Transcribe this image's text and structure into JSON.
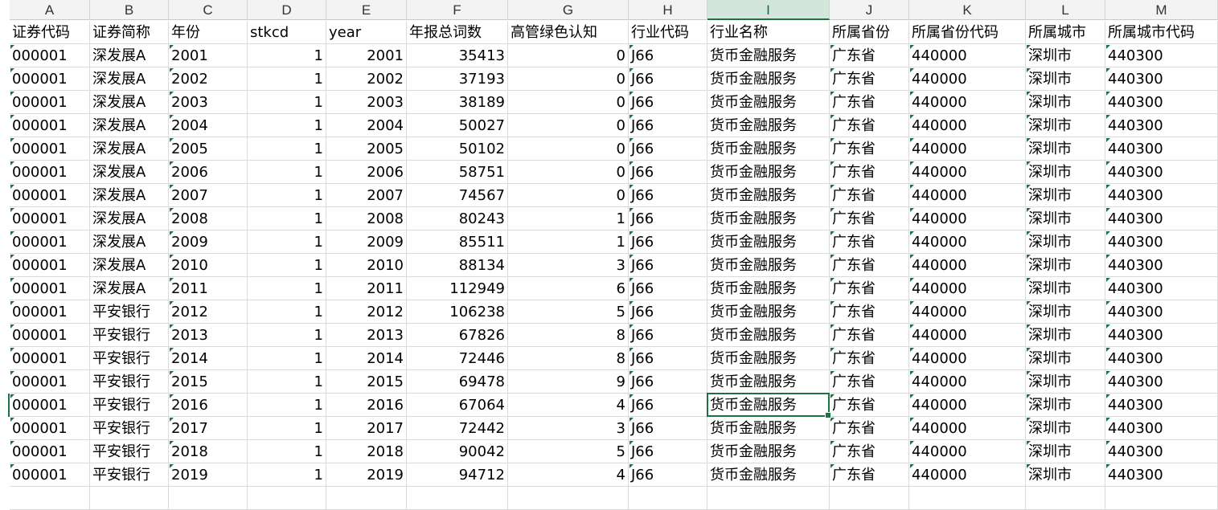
{
  "columns": [
    "A",
    "B",
    "C",
    "D",
    "E",
    "F",
    "G",
    "H",
    "I",
    "J",
    "K",
    "L",
    "M"
  ],
  "active_column": "I",
  "header_row": [
    "证券代码",
    "证券简称",
    "年份",
    "stkcd",
    "year",
    "年报总词数",
    "高管绿色认知",
    "行业代码",
    "行业名称",
    "所属省份",
    "所属省份代码",
    "所属城市",
    "所属城市代码"
  ],
  "rows": [
    [
      "000001",
      "深发展A",
      "2001",
      "1",
      "2001",
      "35413",
      "0",
      "J66",
      "货币金融服务",
      "广东省",
      "440000",
      "深圳市",
      "440300"
    ],
    [
      "000001",
      "深发展A",
      "2002",
      "1",
      "2002",
      "37193",
      "0",
      "J66",
      "货币金融服务",
      "广东省",
      "440000",
      "深圳市",
      "440300"
    ],
    [
      "000001",
      "深发展A",
      "2003",
      "1",
      "2003",
      "38189",
      "0",
      "J66",
      "货币金融服务",
      "广东省",
      "440000",
      "深圳市",
      "440300"
    ],
    [
      "000001",
      "深发展A",
      "2004",
      "1",
      "2004",
      "50027",
      "0",
      "J66",
      "货币金融服务",
      "广东省",
      "440000",
      "深圳市",
      "440300"
    ],
    [
      "000001",
      "深发展A",
      "2005",
      "1",
      "2005",
      "50102",
      "0",
      "J66",
      "货币金融服务",
      "广东省",
      "440000",
      "深圳市",
      "440300"
    ],
    [
      "000001",
      "深发展A",
      "2006",
      "1",
      "2006",
      "58751",
      "0",
      "J66",
      "货币金融服务",
      "广东省",
      "440000",
      "深圳市",
      "440300"
    ],
    [
      "000001",
      "深发展A",
      "2007",
      "1",
      "2007",
      "74567",
      "0",
      "J66",
      "货币金融服务",
      "广东省",
      "440000",
      "深圳市",
      "440300"
    ],
    [
      "000001",
      "深发展A",
      "2008",
      "1",
      "2008",
      "80243",
      "1",
      "J66",
      "货币金融服务",
      "广东省",
      "440000",
      "深圳市",
      "440300"
    ],
    [
      "000001",
      "深发展A",
      "2009",
      "1",
      "2009",
      "85511",
      "1",
      "J66",
      "货币金融服务",
      "广东省",
      "440000",
      "深圳市",
      "440300"
    ],
    [
      "000001",
      "深发展A",
      "2010",
      "1",
      "2010",
      "88134",
      "3",
      "J66",
      "货币金融服务",
      "广东省",
      "440000",
      "深圳市",
      "440300"
    ],
    [
      "000001",
      "深发展A",
      "2011",
      "1",
      "2011",
      "112949",
      "6",
      "J66",
      "货币金融服务",
      "广东省",
      "440000",
      "深圳市",
      "440300"
    ],
    [
      "000001",
      "平安银行",
      "2012",
      "1",
      "2012",
      "106238",
      "5",
      "J66",
      "货币金融服务",
      "广东省",
      "440000",
      "深圳市",
      "440300"
    ],
    [
      "000001",
      "平安银行",
      "2013",
      "1",
      "2013",
      "67826",
      "8",
      "J66",
      "货币金融服务",
      "广东省",
      "440000",
      "深圳市",
      "440300"
    ],
    [
      "000001",
      "平安银行",
      "2014",
      "1",
      "2014",
      "72446",
      "8",
      "J66",
      "货币金融服务",
      "广东省",
      "440000",
      "深圳市",
      "440300"
    ],
    [
      "000001",
      "平安银行",
      "2015",
      "1",
      "2015",
      "69478",
      "9",
      "J66",
      "货币金融服务",
      "广东省",
      "440000",
      "深圳市",
      "440300"
    ],
    [
      "000001",
      "平安银行",
      "2016",
      "1",
      "2016",
      "67064",
      "4",
      "J66",
      "货币金融服务",
      "广东省",
      "440000",
      "深圳市",
      "440300"
    ],
    [
      "000001",
      "平安银行",
      "2017",
      "1",
      "2017",
      "72442",
      "3",
      "J66",
      "货币金融服务",
      "广东省",
      "440000",
      "深圳市",
      "440300"
    ],
    [
      "000001",
      "平安银行",
      "2018",
      "1",
      "2018",
      "90042",
      "5",
      "J66",
      "货币金融服务",
      "广东省",
      "440000",
      "深圳市",
      "440300"
    ],
    [
      "000001",
      "平安银行",
      "2019",
      "1",
      "2019",
      "94712",
      "4",
      "J66",
      "货币金融服务",
      "广东省",
      "440000",
      "深圳市",
      "440300"
    ]
  ],
  "selected_cell": "I17",
  "colors": {
    "accent": "#1e7145",
    "header_bg": "#f3f3f3",
    "active_header_bg": "#d2e6dc"
  }
}
